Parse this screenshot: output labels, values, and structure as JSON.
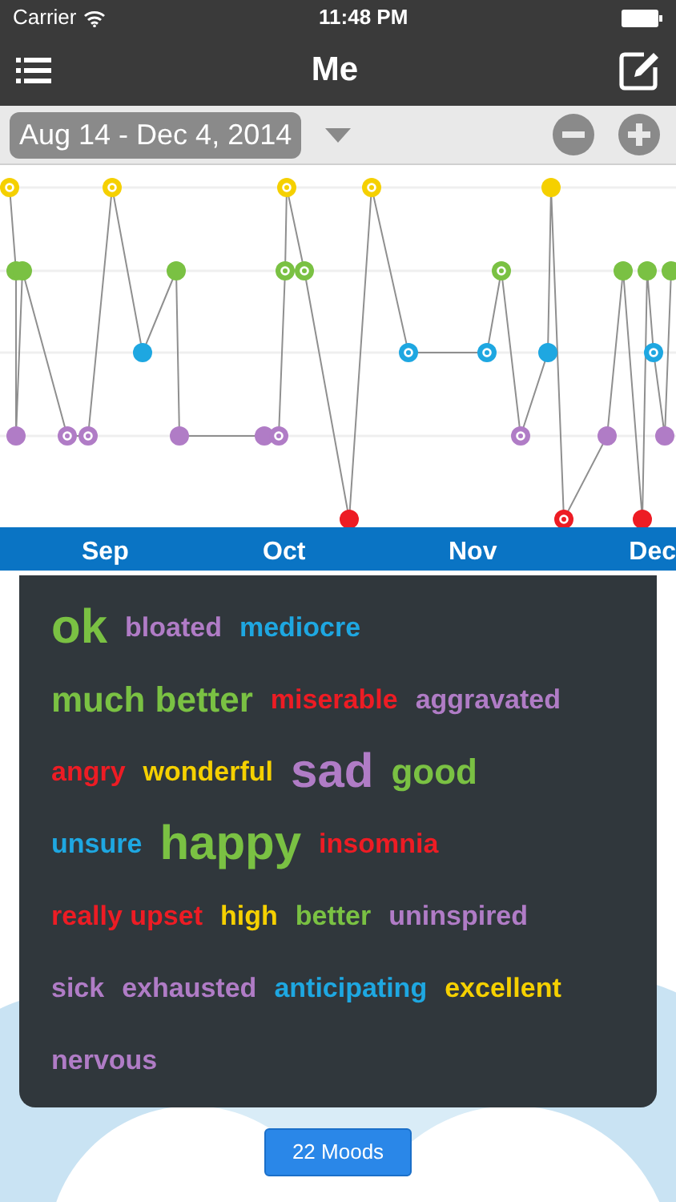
{
  "status_bar": {
    "carrier": "Carrier",
    "time": "11:48 PM"
  },
  "nav": {
    "title": "Me"
  },
  "toolbar": {
    "date_range": "Aug 14 - Dec 4, 2014"
  },
  "chart": {
    "months": [
      "Sep",
      "Oct",
      "Nov",
      "Dec"
    ]
  },
  "mood_rows": [
    {
      "words": [
        {
          "text": "ok",
          "color": "#7ac143",
          "kind": "xl"
        },
        {
          "text": "bloated",
          "color": "#b07cc6",
          "kind": "md"
        },
        {
          "text": "mediocre",
          "color": "#1ea7e1",
          "kind": "md"
        }
      ]
    },
    {
      "words": [
        {
          "text": "much better",
          "color": "#7ac143",
          "kind": "lg"
        },
        {
          "text": "miserable",
          "color": "#ed1c24",
          "kind": "md"
        },
        {
          "text": "aggravated",
          "color": "#b07cc6",
          "kind": "md"
        }
      ]
    },
    {
      "words": [
        {
          "text": "angry",
          "color": "#ed1c24",
          "kind": "md"
        },
        {
          "text": "wonderful",
          "color": "#f5d000",
          "kind": "md"
        },
        {
          "text": "sad",
          "color": "#b07cc6",
          "kind": "xl"
        },
        {
          "text": "good",
          "color": "#7ac143",
          "kind": "lg"
        }
      ]
    },
    {
      "words": [
        {
          "text": "unsure",
          "color": "#1ea7e1",
          "kind": "md"
        },
        {
          "text": "happy",
          "color": "#7ac143",
          "kind": "xl"
        },
        {
          "text": "insomnia",
          "color": "#ed1c24",
          "kind": "md"
        }
      ]
    },
    {
      "words": [
        {
          "text": "really upset",
          "color": "#ed1c24",
          "kind": "md"
        },
        {
          "text": "high",
          "color": "#f5d000",
          "kind": "md"
        },
        {
          "text": "better",
          "color": "#7ac143",
          "kind": "md"
        },
        {
          "text": "uninspired",
          "color": "#b07cc6",
          "kind": "md"
        }
      ]
    },
    {
      "words": [
        {
          "text": "sick",
          "color": "#b07cc6",
          "kind": "md"
        },
        {
          "text": "exhausted",
          "color": "#b07cc6",
          "kind": "md"
        },
        {
          "text": "anticipating",
          "color": "#1ea7e1",
          "kind": "md"
        },
        {
          "text": "excellent",
          "color": "#f5d000",
          "kind": "md"
        }
      ]
    },
    {
      "words": [
        {
          "text": "nervous",
          "color": "#b07cc6",
          "kind": "md"
        }
      ]
    }
  ],
  "footer_button": "22 Moods"
}
